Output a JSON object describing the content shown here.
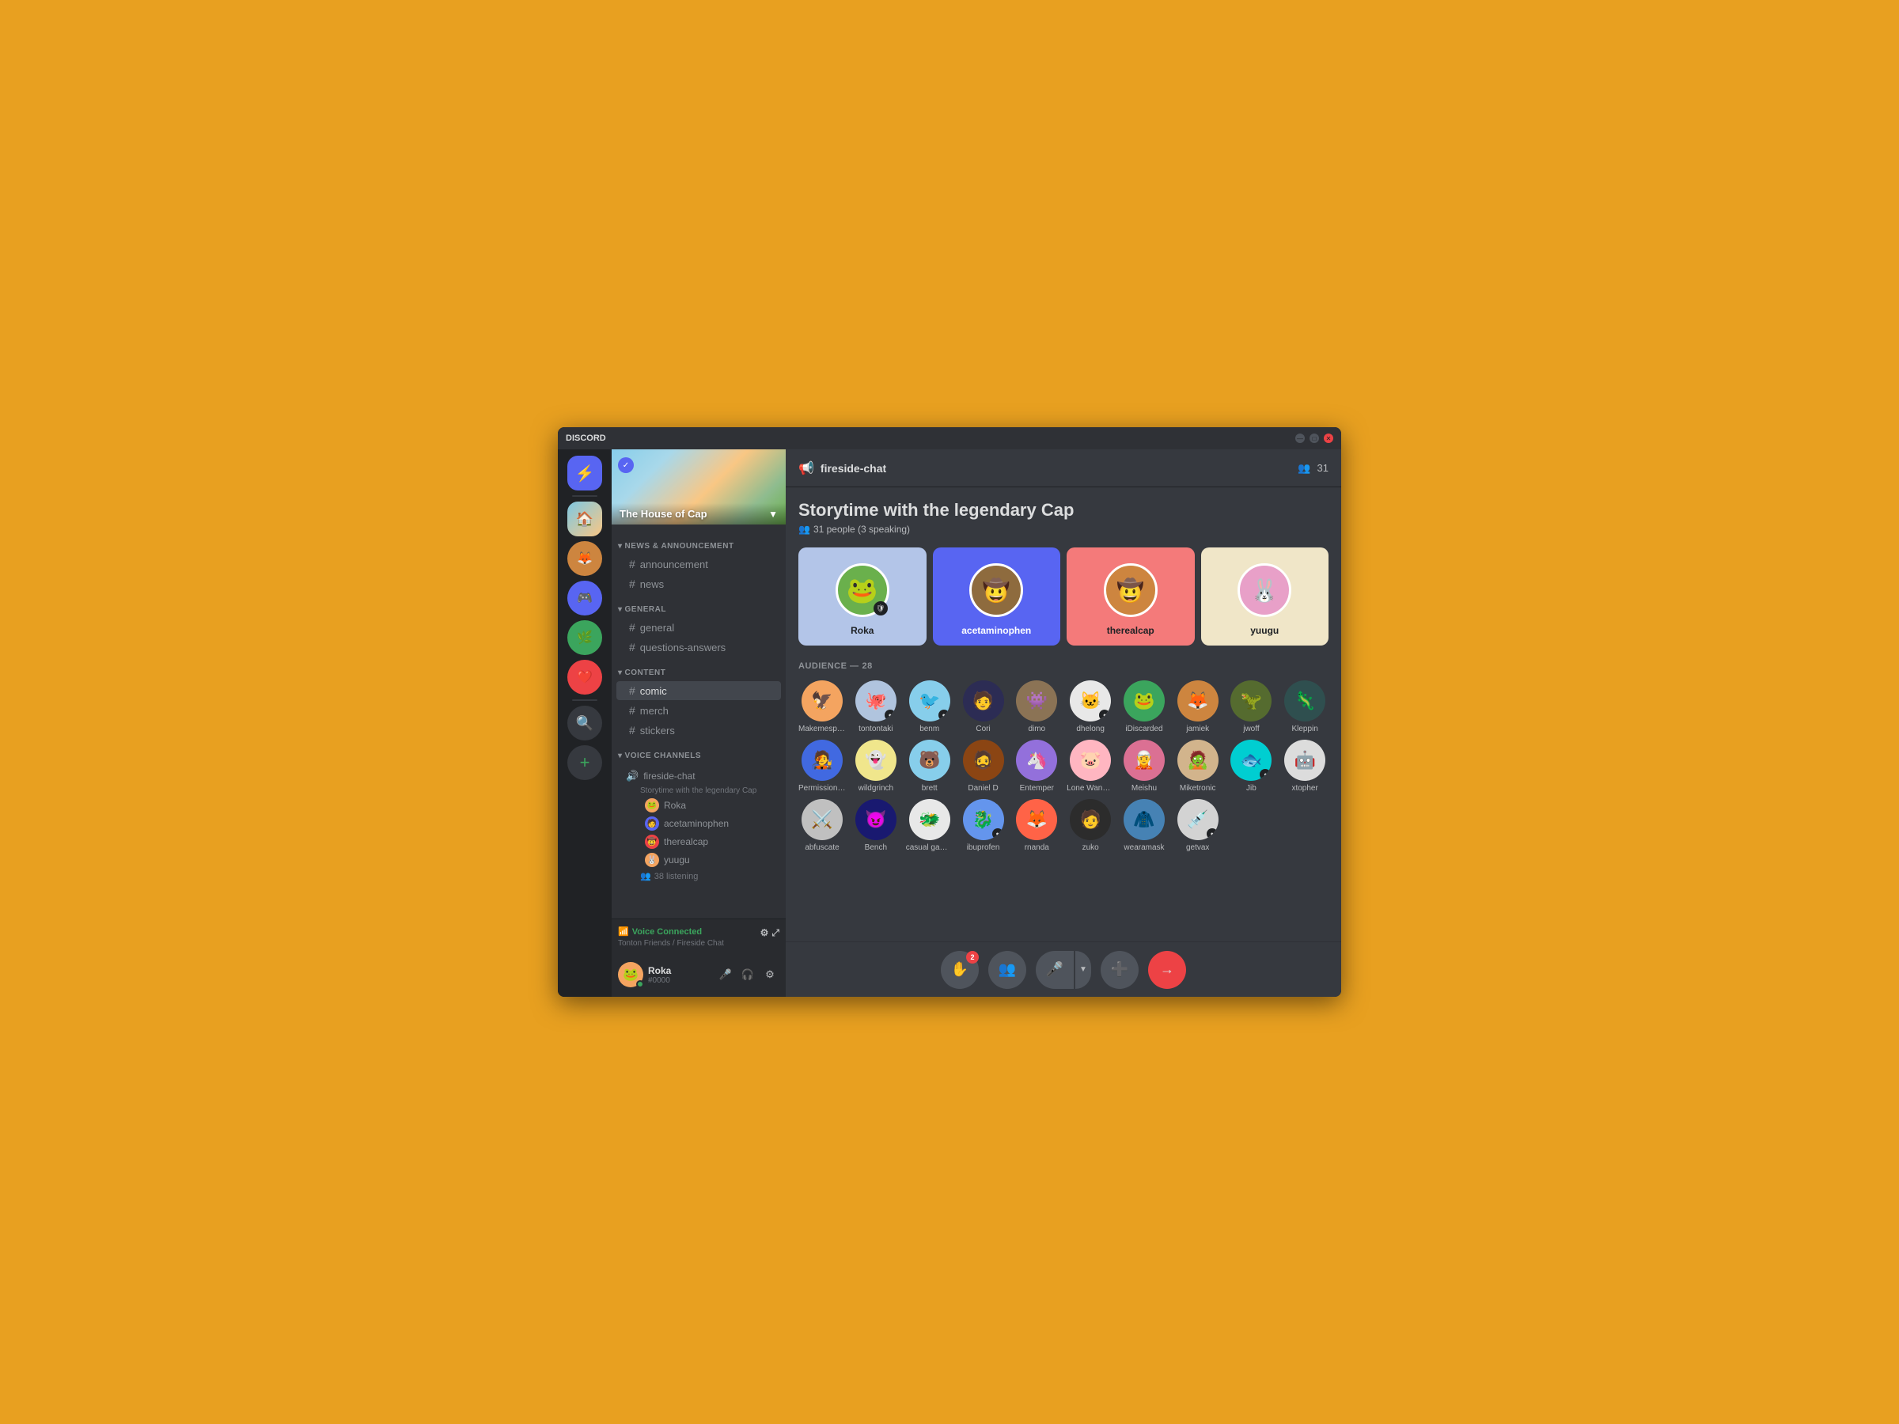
{
  "window": {
    "title": "DISCORD",
    "controls": [
      "—",
      "□",
      "✕"
    ]
  },
  "server": {
    "name": "The House of Cap",
    "verified": true,
    "header_bg": "linear-gradient"
  },
  "categories": [
    {
      "name": "NEWS & ANNOUNCEMENT",
      "channels": [
        {
          "name": "announcement",
          "type": "text"
        },
        {
          "name": "news",
          "type": "text"
        }
      ]
    },
    {
      "name": "GENERAL",
      "channels": [
        {
          "name": "general",
          "type": "text"
        },
        {
          "name": "questions-answers",
          "type": "text"
        }
      ]
    },
    {
      "name": "CONTENT",
      "channels": [
        {
          "name": "comic",
          "type": "text",
          "active": true
        },
        {
          "name": "merch",
          "type": "text"
        },
        {
          "name": "stickers",
          "type": "text"
        }
      ]
    }
  ],
  "voice_channels": {
    "category": "VOICE CHANNELS",
    "channel": {
      "name": "fireside-chat",
      "subtitle": "Storytime with the legendary Cap",
      "users": [
        {
          "name": "Roka",
          "color": "#f4a460"
        },
        {
          "name": "acetaminophen",
          "color": "#5865f2"
        },
        {
          "name": "therealcap",
          "color": "#ed4245"
        },
        {
          "name": "yuugu",
          "color": "#f4a460"
        }
      ],
      "listening": "38 listening"
    }
  },
  "voice_connected": {
    "label": "Voice Connected",
    "channel": "Tonton Friends / Fireside Chat"
  },
  "user": {
    "name": "Roka",
    "tag": "#0000",
    "controls": [
      "🎤",
      "🎧",
      "⚙"
    ]
  },
  "channel_header": {
    "icon": "📢",
    "name": "fireside-chat",
    "member_count": "31"
  },
  "stage": {
    "title": "Storytime with the legendary Cap",
    "meta": "31 people (3 speaking)",
    "speakers": [
      {
        "name": "Roka",
        "color_class": "card-blue",
        "emoji": "🐸",
        "bg": "#6ab04c",
        "has_badge": true
      },
      {
        "name": "acetaminophen",
        "color_class": "card-blue2",
        "emoji": "🧑",
        "bg": "#8e6b3e",
        "has_badge": false
      },
      {
        "name": "therealcap",
        "color_class": "card-pink",
        "emoji": "🤠",
        "bg": "#cd853f",
        "has_badge": false
      },
      {
        "name": "yuugu",
        "color_class": "card-cream",
        "emoji": "🐰",
        "bg": "#e8a0c8",
        "has_badge": false
      }
    ],
    "audience_count": "28",
    "audience": [
      {
        "name": "Makemespeakrr",
        "emoji": "🦅",
        "bg": "#f4a460"
      },
      {
        "name": "tontontaki",
        "emoji": "🐙",
        "bg": "#b0c4de",
        "badge": true
      },
      {
        "name": "benm",
        "emoji": "🐦",
        "bg": "#87ceeb",
        "badge": true
      },
      {
        "name": "Cori",
        "emoji": "🧑",
        "bg": "#2c2c54"
      },
      {
        "name": "dimo",
        "emoji": "👾",
        "bg": "#8b7355"
      },
      {
        "name": "dhelong",
        "emoji": "🐱",
        "bg": "#e8e8e8",
        "badge": true
      },
      {
        "name": "iDiscarded",
        "emoji": "🐸",
        "bg": "#3ba55d"
      },
      {
        "name": "jamiek",
        "emoji": "🦊",
        "bg": "#cd853f"
      },
      {
        "name": "jwoff",
        "emoji": "🦖",
        "bg": "#556b2f"
      },
      {
        "name": "Kleppin",
        "emoji": "🦎",
        "bg": "#2f4f4f"
      },
      {
        "name": "Permission Man",
        "emoji": "🧑‍🎤",
        "bg": "#4169e1"
      },
      {
        "name": "wildgrinch",
        "emoji": "👻",
        "bg": "#f0e68c"
      },
      {
        "name": "brett",
        "emoji": "🐻",
        "bg": "#87ceeb"
      },
      {
        "name": "Daniel D",
        "emoji": "🧔",
        "bg": "#8b4513"
      },
      {
        "name": "Entemper",
        "emoji": "🦄",
        "bg": "#9370db"
      },
      {
        "name": "Lone Wanderer",
        "emoji": "🐷",
        "bg": "#ffb6c1"
      },
      {
        "name": "Meishu",
        "emoji": "🧝",
        "bg": "#db7093"
      },
      {
        "name": "Miketronic",
        "emoji": "🧟",
        "bg": "#d2b48c"
      },
      {
        "name": "Jib",
        "emoji": "🐟",
        "bg": "#00ced1",
        "badge": true
      },
      {
        "name": "xtopher",
        "emoji": "🤖",
        "bg": "#dcdcdc"
      },
      {
        "name": "abfuscate",
        "emoji": "⚔️",
        "bg": "#c0c0c0"
      },
      {
        "name": "Bench",
        "emoji": "😈",
        "bg": "#191970"
      },
      {
        "name": "casual gamer",
        "emoji": "🐲",
        "bg": "#e8e8e8"
      },
      {
        "name": "ibuprofen",
        "emoji": "🐉",
        "bg": "#6495ed",
        "badge": true
      },
      {
        "name": "rnanda",
        "emoji": "🦊",
        "bg": "#ff6347"
      },
      {
        "name": "zuko",
        "emoji": "🧑",
        "bg": "#2c2c2c"
      },
      {
        "name": "wearamask",
        "emoji": "🧥",
        "bg": "#4682b4"
      },
      {
        "name": "getvax",
        "emoji": "💉",
        "bg": "#d3d3d3",
        "badge": true
      }
    ]
  },
  "action_bar": {
    "hand_badge": "2",
    "buttons": [
      "hand",
      "people",
      "mic",
      "add-user",
      "leave"
    ]
  }
}
